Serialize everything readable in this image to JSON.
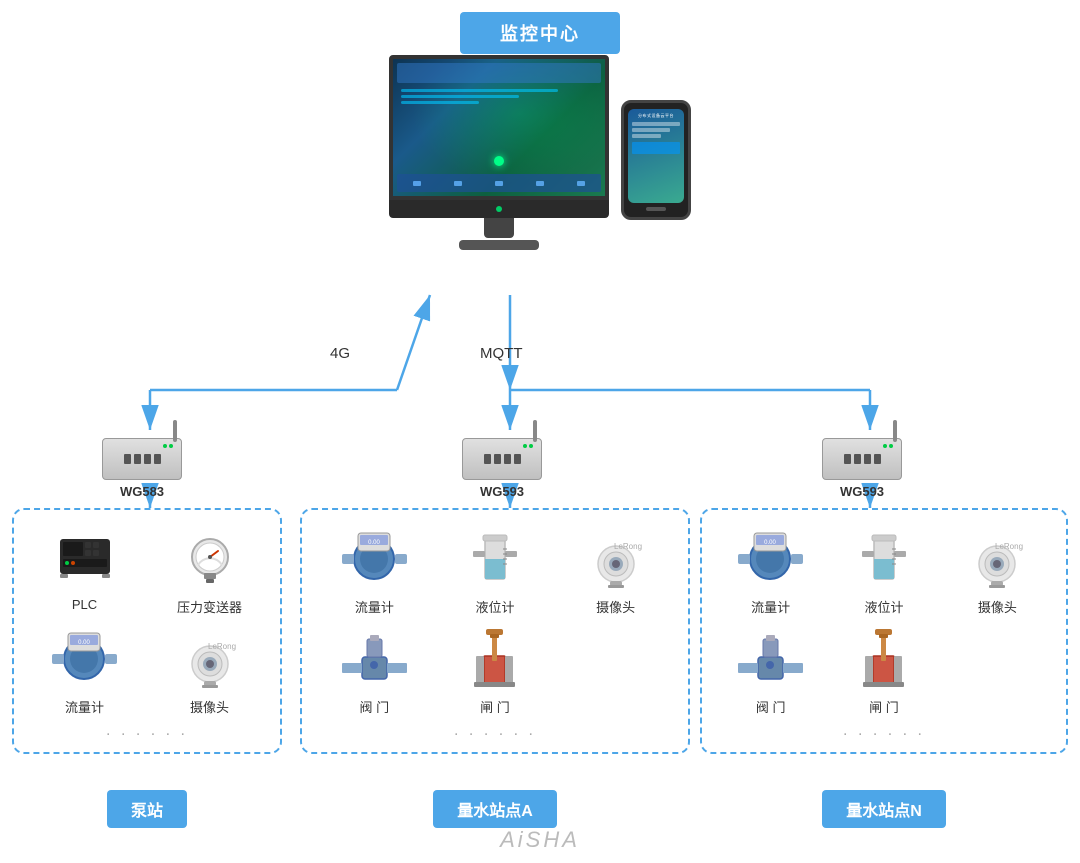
{
  "page": {
    "title": "监控中心",
    "protocol_4g": "4G",
    "protocol_mqtt": "MQTT",
    "watermark": "AiSHA"
  },
  "gateways": [
    {
      "id": "wg583",
      "label": "WG583"
    },
    {
      "id": "wg593a",
      "label": "WG593"
    },
    {
      "id": "wg593n",
      "label": "WG593"
    }
  ],
  "stations": [
    {
      "id": "pump",
      "label": "泵站",
      "devices": [
        {
          "id": "plc",
          "name": "PLC"
        },
        {
          "id": "pressure",
          "name": "压力变送器"
        },
        {
          "id": "flowmeter1",
          "name": "流量计"
        },
        {
          "id": "camera1",
          "name": "摄像头"
        }
      ],
      "cols": 2
    },
    {
      "id": "stationA",
      "label": "量水站点A",
      "devices": [
        {
          "id": "flowmeter2",
          "name": "流量计"
        },
        {
          "id": "levelmeter1",
          "name": "液位计"
        },
        {
          "id": "camera2",
          "name": "摄像头"
        },
        {
          "id": "valve1",
          "name": "阀 门"
        },
        {
          "id": "gate1",
          "name": "闸 门"
        }
      ],
      "cols": 3
    },
    {
      "id": "stationN",
      "label": "量水站点N",
      "devices": [
        {
          "id": "flowmeter3",
          "name": "流量计"
        },
        {
          "id": "levelmeter2",
          "name": "液位计"
        },
        {
          "id": "camera3",
          "name": "摄像头"
        },
        {
          "id": "valve2",
          "name": "阀 门"
        },
        {
          "id": "gate2",
          "name": "闸 门"
        }
      ],
      "cols": 3
    }
  ]
}
